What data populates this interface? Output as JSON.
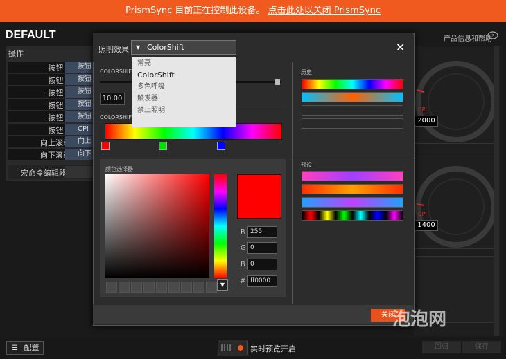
{
  "banner": {
    "text": "PrismSync 目前正在控制此设备。",
    "link": "点击此处以关闭 PrismSync"
  },
  "app": {
    "title": "DEFAULT",
    "help": "产品信息和帮助"
  },
  "ops": {
    "title": "操作",
    "rows": [
      {
        "label": "按钮 1",
        "value": "按钮"
      },
      {
        "label": "按钮 2",
        "value": "按钮"
      },
      {
        "label": "按钮 3",
        "value": "按钮"
      },
      {
        "label": "按钮 4",
        "value": "按钮"
      },
      {
        "label": "按钮 5",
        "value": "按钮"
      },
      {
        "label": "按钮 6",
        "value": "CPI"
      },
      {
        "label": "向上滚动",
        "value": "向上"
      },
      {
        "label": "向下滚动",
        "value": "向下"
      }
    ],
    "macro": "宏命令编辑器"
  },
  "dialog": {
    "effect_label": "照明效果",
    "effect_value": "ColorShift",
    "options": [
      "常亮",
      "ColorShift",
      "多色呼吸",
      "触发器",
      "禁止照明"
    ],
    "section1": "COLORSHIFT",
    "speed": "10.00",
    "section2": "COLORSHIFT",
    "picker_title": "颜色选择器",
    "rgb": {
      "r": "255",
      "g": "0",
      "b": "0",
      "hex": "ff0000",
      "rl": "R",
      "gl": "G",
      "bl": "B",
      "hl": "#"
    },
    "history_title": "历史",
    "preset_title": "预设",
    "close": "关闭"
  },
  "gauges": [
    {
      "label": "CPI",
      "value": "2000"
    },
    {
      "label": "CPI",
      "value": "1400"
    }
  ],
  "bottom": {
    "config": "配置",
    "preview": "实时预览开启",
    "revert": "回归",
    "save": "保存"
  },
  "watermark": "泡泡网",
  "colors": {
    "accent": "#f05a1e",
    "swatch": "#ff0000"
  }
}
